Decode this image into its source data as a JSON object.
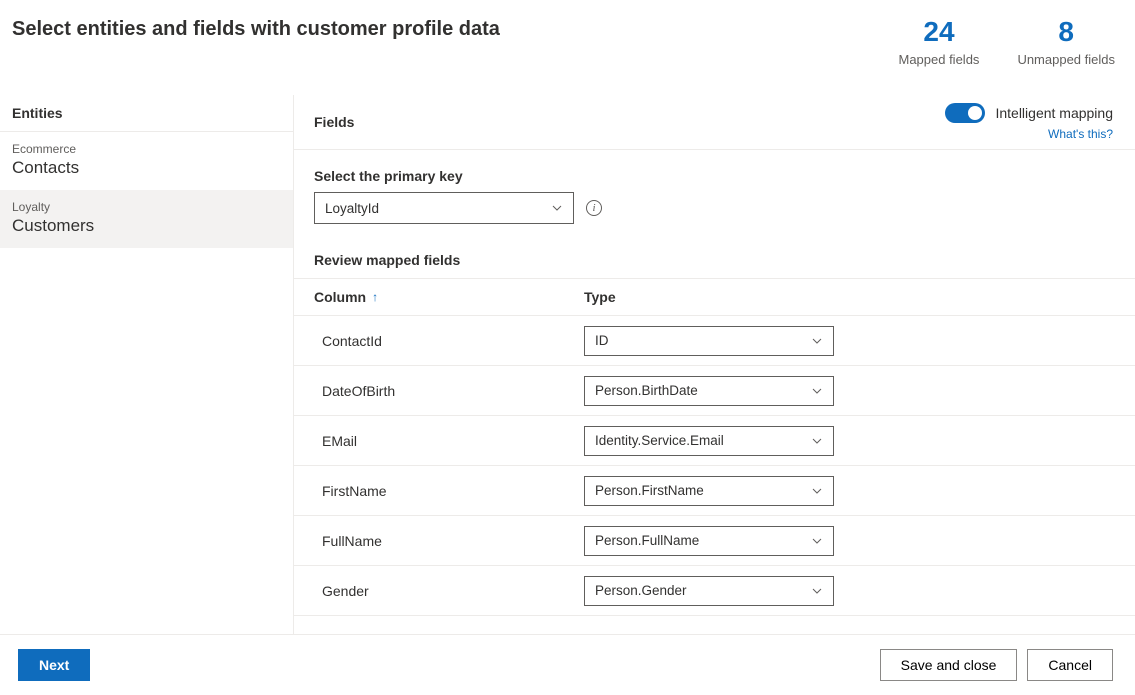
{
  "page": {
    "title": "Select entities and fields with customer profile data"
  },
  "stats": {
    "mapped": {
      "value": "24",
      "label": "Mapped fields"
    },
    "unmapped": {
      "value": "8",
      "label": "Unmapped fields"
    }
  },
  "sidebar": {
    "header": "Entities",
    "items": [
      {
        "source": "Ecommerce",
        "name": "Contacts",
        "selected": false
      },
      {
        "source": "Loyalty",
        "name": "Customers",
        "selected": true
      }
    ]
  },
  "main": {
    "fields_label": "Fields",
    "intelligent_mapping": {
      "label": "Intelligent mapping",
      "whats_this": "What's this?",
      "enabled": true
    },
    "primary_key": {
      "label": "Select the primary key",
      "value": "LoyaltyId"
    },
    "review_label": "Review mapped fields",
    "table": {
      "header_column": "Column",
      "header_type": "Type",
      "sort_asc": true,
      "rows": [
        {
          "column": "ContactId",
          "type": "ID"
        },
        {
          "column": "DateOfBirth",
          "type": "Person.BirthDate"
        },
        {
          "column": "EMail",
          "type": "Identity.Service.Email"
        },
        {
          "column": "FirstName",
          "type": "Person.FirstName"
        },
        {
          "column": "FullName",
          "type": "Person.FullName"
        },
        {
          "column": "Gender",
          "type": "Person.Gender"
        }
      ]
    }
  },
  "footer": {
    "next": "Next",
    "save_close": "Save and close",
    "cancel": "Cancel"
  }
}
